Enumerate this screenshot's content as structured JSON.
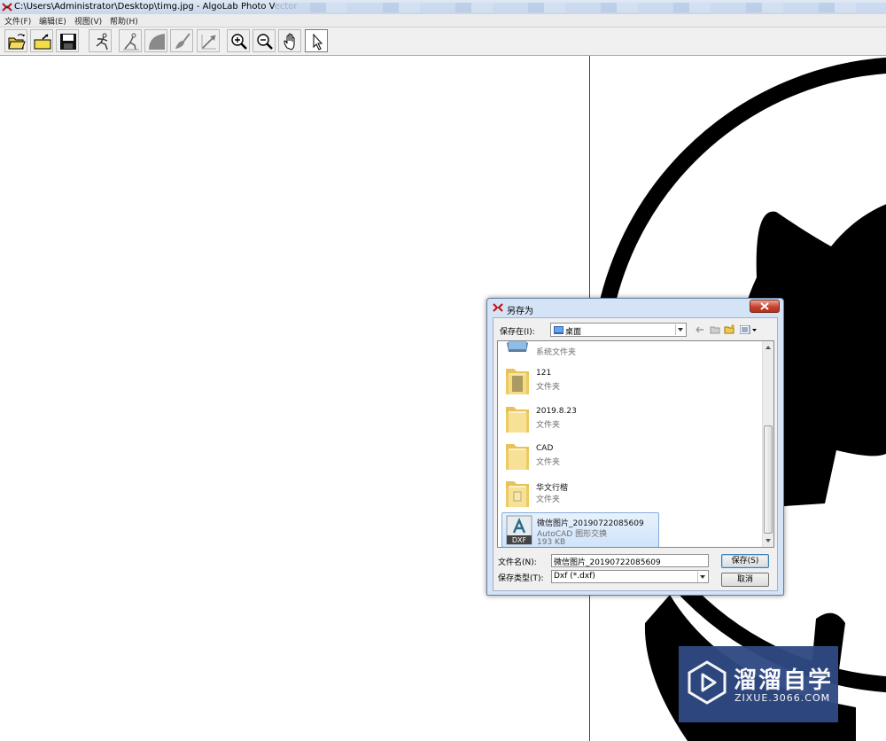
{
  "window": {
    "title": "C:\\Users\\Administrator\\Desktop\\timg.jpg - AlgoLab Photo Vector"
  },
  "menu": [
    "文件(F)",
    "编辑(E)",
    "视图(V)",
    "帮助(H)"
  ],
  "toolbar": {
    "buttons": [
      {
        "name": "open-icon"
      },
      {
        "name": "open-folder-icon"
      },
      {
        "name": "save-icon"
      },
      {
        "name": "vectorize-figure-icon"
      },
      {
        "name": "figure-trace-icon"
      },
      {
        "name": "shape-icon"
      },
      {
        "name": "brush-icon"
      },
      {
        "name": "line-tool-icon"
      },
      {
        "name": "zoom-in-icon"
      },
      {
        "name": "zoom-out-icon"
      },
      {
        "name": "hand-pan-icon"
      },
      {
        "name": "pointer-arrow-icon"
      }
    ],
    "active": "pointer-arrow-icon"
  },
  "dialog": {
    "title": "另存为",
    "save_in_label": "保存在(I):",
    "save_in_value": "桌面",
    "items": [
      {
        "name": "",
        "type": "系统文件夹",
        "kind": "system"
      },
      {
        "name": "121",
        "type": "文件夹",
        "kind": "folder"
      },
      {
        "name": "2019.8.23",
        "type": "文件夹",
        "kind": "folder"
      },
      {
        "name": "CAD",
        "type": "文件夹",
        "kind": "folder"
      },
      {
        "name": "华文行楷",
        "type": "文件夹",
        "kind": "folder"
      },
      {
        "name": "微信图片_20190722085609",
        "type": "AutoCAD 图形交换",
        "size": "193 KB",
        "kind": "dxf",
        "selected": true
      }
    ],
    "dxf_badge": "DXF",
    "filename_label": "文件名(N):",
    "filename_value": "微信图片_20190722085609",
    "filetype_label": "保存类型(T):",
    "filetype_value": "Dxf (*.dxf)",
    "save_button": "保存(S)",
    "cancel_button": "取消"
  },
  "watermark": {
    "text_cn": "溜溜自学",
    "text_en": "ZIXUE.3066.COM"
  },
  "colors": {
    "canvas_shape": "#000000",
    "dialog_frame": "#d4e3f5",
    "watermark_bg": "#2f4a84"
  }
}
